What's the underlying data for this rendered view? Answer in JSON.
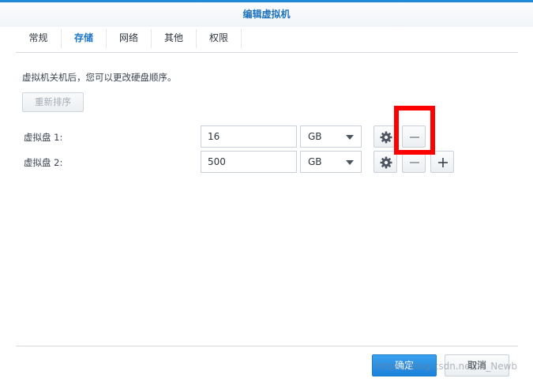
{
  "window": {
    "title": "编辑虚拟机"
  },
  "tabs": [
    {
      "label": "常规"
    },
    {
      "label": "存储",
      "active": true
    },
    {
      "label": "网络"
    },
    {
      "label": "其他"
    },
    {
      "label": "权限"
    }
  ],
  "storage": {
    "hint": "虚拟机关机后，您可以更改硬盘顺序。",
    "reorder_button": "重新排序",
    "disks": [
      {
        "label": "虚拟盘 1:",
        "size": "16",
        "unit": "GB"
      },
      {
        "label": "虚拟盘 2:",
        "size": "500",
        "unit": "GB"
      }
    ]
  },
  "footer": {
    "ok_label": "确定",
    "cancel_label": "取消"
  },
  "watermark": "https://blog.csdn.net/IT_Newb",
  "colors": {
    "accent": "#1f8ad8",
    "highlight": "#ff0000"
  },
  "icons": [
    "gear-icon",
    "minus-icon",
    "plus-icon",
    "chevron-down-icon"
  ]
}
